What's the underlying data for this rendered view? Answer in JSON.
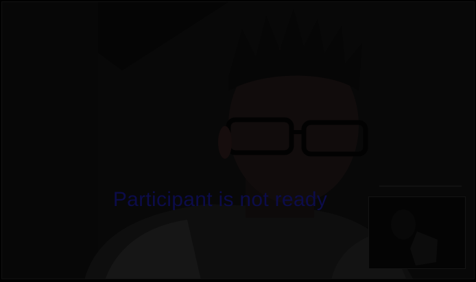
{
  "call": {
    "status_text": "Participant is not ready"
  },
  "icons": {
    "remote_video": "remote-participant-video",
    "self_view": "self-view-video"
  },
  "colors": {
    "status_text": "#0c0c4a",
    "background": "#080808"
  }
}
